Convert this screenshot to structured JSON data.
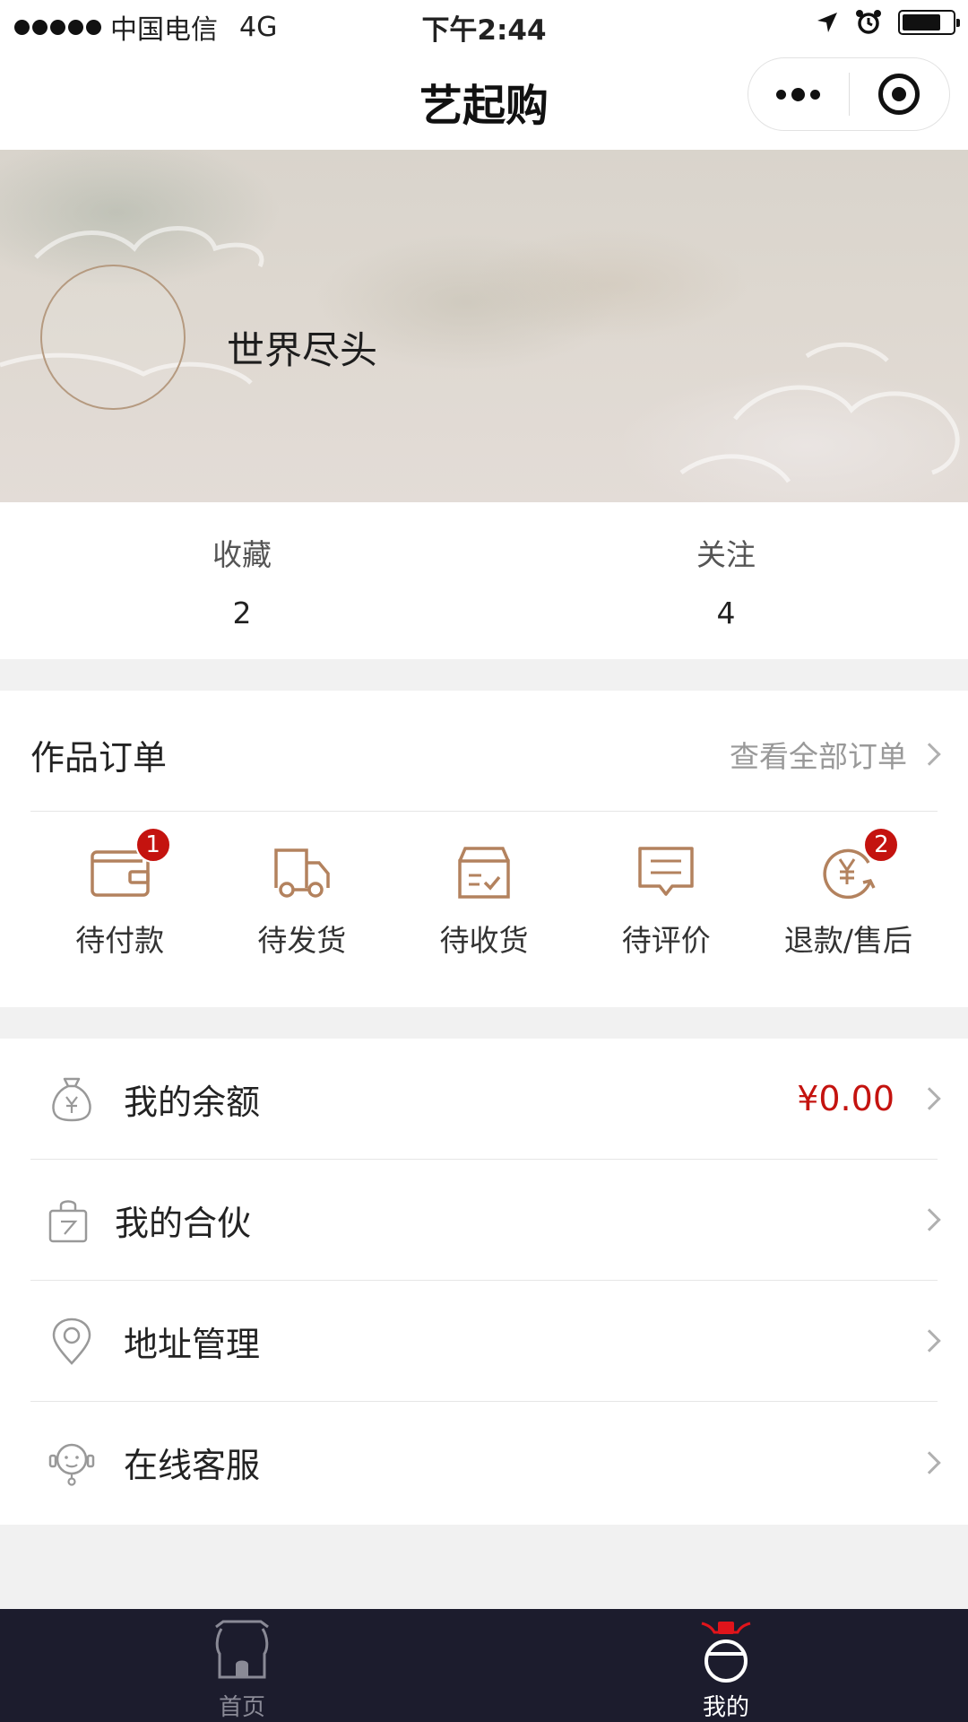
{
  "status_bar": {
    "carrier": "中国电信",
    "network": "4G",
    "time": "下午2:44"
  },
  "nav": {
    "title": "艺起购",
    "more_icon": "more-dots-icon",
    "close_icon": "target-circle-icon"
  },
  "profile": {
    "username": "世界尽头"
  },
  "stats": [
    {
      "label": "收藏",
      "value": "2"
    },
    {
      "label": "关注",
      "value": "4"
    }
  ],
  "orders": {
    "title": "作品订单",
    "view_all": "查看全部订单",
    "items": [
      {
        "label": "待付款",
        "icon": "wallet-icon",
        "badge": "1"
      },
      {
        "label": "待发货",
        "icon": "truck-icon",
        "badge": ""
      },
      {
        "label": "待收货",
        "icon": "box-check-icon",
        "badge": ""
      },
      {
        "label": "待评价",
        "icon": "comment-icon",
        "badge": ""
      },
      {
        "label": "退款/售后",
        "icon": "refund-yen-icon",
        "badge": "2"
      }
    ]
  },
  "menu": [
    {
      "label": "我的余额",
      "icon": "money-bag-icon",
      "value": "¥0.00"
    },
    {
      "label": "我的合伙",
      "icon": "shopping-bag-icon",
      "value": ""
    },
    {
      "label": "地址管理",
      "icon": "location-pin-icon",
      "value": ""
    },
    {
      "label": "在线客服",
      "icon": "headset-service-icon",
      "value": ""
    }
  ],
  "tabs": [
    {
      "label": "首页",
      "icon": "home-icon",
      "active": false
    },
    {
      "label": "我的",
      "icon": "profile-jar-icon",
      "active": true
    }
  ],
  "colors": {
    "accent_gold": "#b3825e",
    "price_red": "#c4130f",
    "badge_red": "#c4130f",
    "tab_bar_bg": "#1c1c2d"
  }
}
